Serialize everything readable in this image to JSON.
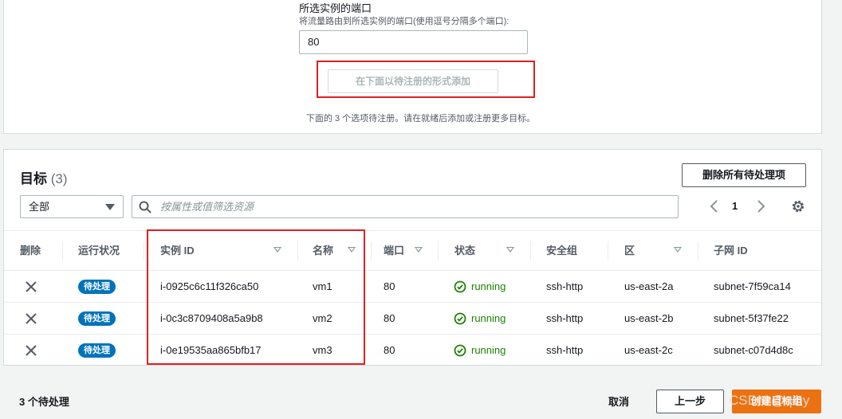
{
  "port_section": {
    "title": "所选实例的端口",
    "description": "将流量路由到所选实例的端口(使用逗号分隔多个端口):",
    "value": "80",
    "add_button": "在下面以待注册的形式添加",
    "pending_note": "下面的 3 个选项待注册。请在就绪后添加或注册更多目标。"
  },
  "targets": {
    "title": "目标",
    "count": "(3)",
    "remove_all_button": "删除所有待处理项",
    "filter_select": "全部",
    "search_placeholder": "按属性或值筛选资源",
    "page": "1",
    "columns": {
      "remove": "删除",
      "health": "运行状况",
      "instance_id": "实例 ID",
      "name": "名称",
      "port": "端口",
      "state": "状态",
      "security_group": "安全组",
      "zone": "区",
      "subnet_id": "子网 ID"
    },
    "rows": [
      {
        "health": "待处理",
        "instance_id": "i-0925c6c11f326ca50",
        "name": "vm1",
        "port": "80",
        "state": "running",
        "security_group": "ssh-http",
        "zone": "us-east-2a",
        "subnet_id": "subnet-7f59ca14"
      },
      {
        "health": "待处理",
        "instance_id": "i-0c3c8709408a5a9b8",
        "name": "vm2",
        "port": "80",
        "state": "running",
        "security_group": "ssh-http",
        "zone": "us-east-2b",
        "subnet_id": "subnet-5f37fe22"
      },
      {
        "health": "待处理",
        "instance_id": "i-0e19535aa865bfb17",
        "name": "vm3",
        "port": "80",
        "state": "running",
        "security_group": "ssh-http",
        "zone": "us-east-2c",
        "subnet_id": "subnet-c07d4d8c"
      }
    ]
  },
  "footer": {
    "pending_count": "3 个待处理",
    "cancel": "取消",
    "previous": "上一步",
    "create": "创建目标组",
    "watermark": "CSDN @qlhy"
  },
  "colors": {
    "accent_orange": "#ec7211",
    "badge_blue": "#0073bb",
    "running_green": "#1d8102",
    "highlight_red": "#e02020"
  }
}
